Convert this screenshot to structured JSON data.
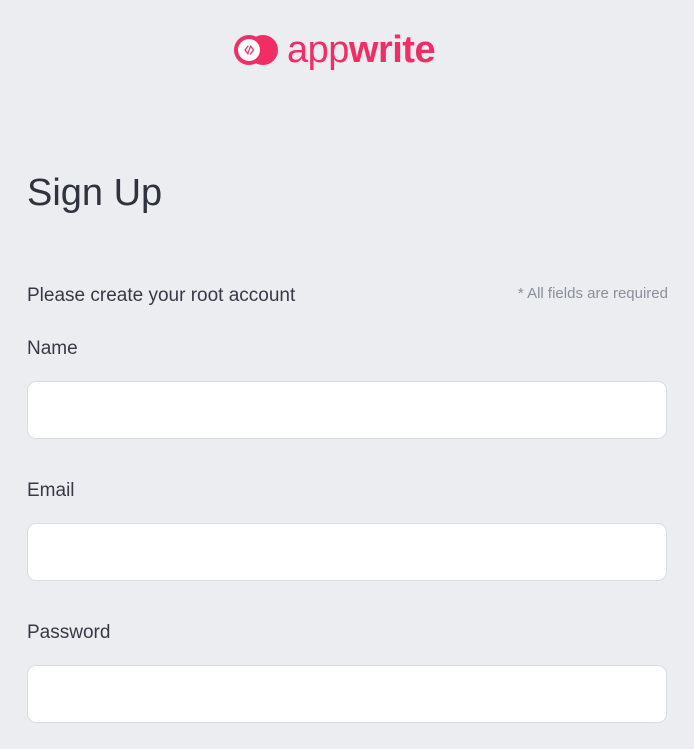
{
  "brand": {
    "name_light": "app",
    "name_bold": "write",
    "accent_color": "#f02e65",
    "logo_icon": "code-brackets-icon"
  },
  "page": {
    "title": "Sign Up",
    "intro": "Please create your root account",
    "required_note": "* All fields are required"
  },
  "form": {
    "name": {
      "label": "Name",
      "value": "",
      "placeholder": ""
    },
    "email": {
      "label": "Email",
      "value": "",
      "placeholder": ""
    },
    "password": {
      "label": "Password",
      "value": "",
      "placeholder": ""
    }
  }
}
